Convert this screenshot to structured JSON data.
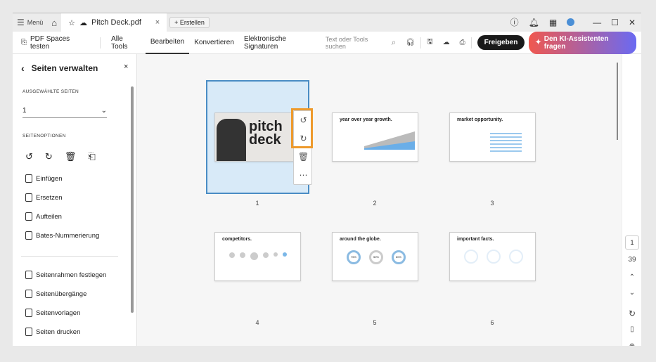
{
  "tabbar": {
    "menu": "Menü",
    "doc_tab": "Pitch Deck.pdf",
    "new_button": "Erstellen"
  },
  "toolbar": {
    "spaces": "PDF Spaces testen",
    "nav": [
      "Alle Tools",
      "Bearbeiten",
      "Konvertieren",
      "Elektronische Signaturen"
    ],
    "active_nav": "Bearbeiten",
    "search_placeholder": "Text oder Tools suchen",
    "share": "Freigeben",
    "ai": "Den KI-Assistenten fragen"
  },
  "panel": {
    "title": "Seiten verwalten",
    "selected_label": "AUSGEWÄHLTE SEITEN",
    "selected_value": "1",
    "options_label": "SEITENOPTIONEN",
    "items": [
      "Einfügen",
      "Ersetzen",
      "Aufteilen",
      "Bates-Nummerierung"
    ],
    "items2": [
      "Seitenrahmen festlegen",
      "Seitenübergänge",
      "Seitenvorlagen",
      "Seiten drucken"
    ]
  },
  "pages": [
    {
      "num": "1",
      "title": "pitch deck"
    },
    {
      "num": "2",
      "title": "year over year growth."
    },
    {
      "num": "3",
      "title": "market opportunity."
    },
    {
      "num": "4",
      "title": "competitors."
    },
    {
      "num": "5",
      "title": "around the globe."
    },
    {
      "num": "6",
      "title": "important facts."
    }
  ],
  "globe_stats": [
    "75%",
    "50%",
    "60%"
  ],
  "rail": {
    "current_page": "1",
    "total_pages": "39"
  },
  "colors": {
    "accent": "#4a8cc4",
    "highlight": "#ee9a2c",
    "selection": "#d8eaf8"
  }
}
